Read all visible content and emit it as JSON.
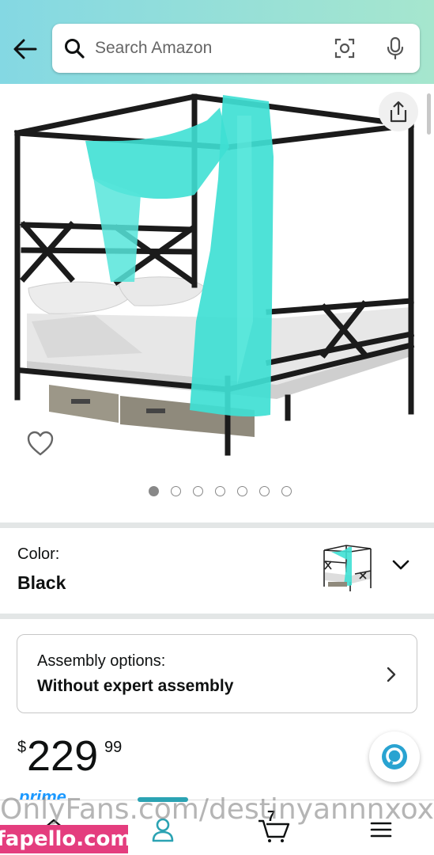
{
  "header": {
    "search_placeholder": "Search Amazon",
    "icons": {
      "back": "arrow-left-icon",
      "search": "search-icon",
      "camera": "camera-lens-icon",
      "mic": "microphone-icon"
    }
  },
  "product_image": {
    "carousel_count": 7,
    "carousel_active_index": 0,
    "icons": {
      "share": "share-icon",
      "wishlist": "heart-icon"
    }
  },
  "color": {
    "label": "Color:",
    "value": "Black"
  },
  "assembly": {
    "label": "Assembly options:",
    "value": "Without expert assembly"
  },
  "price": {
    "currency": "$",
    "whole": "229",
    "fraction": "99"
  },
  "prime_text": "prime",
  "bottom_nav": {
    "cart_count": "7",
    "active": "account"
  },
  "watermark": "OnlyFans.com/destinyannnxox",
  "badge": "fapello.com",
  "colors": {
    "header_start": "#84d8e3",
    "header_end": "#a6e6ce",
    "accent": "#2ba3b3",
    "curtain": "#3fe0d4",
    "badge": "#e43d7e"
  }
}
